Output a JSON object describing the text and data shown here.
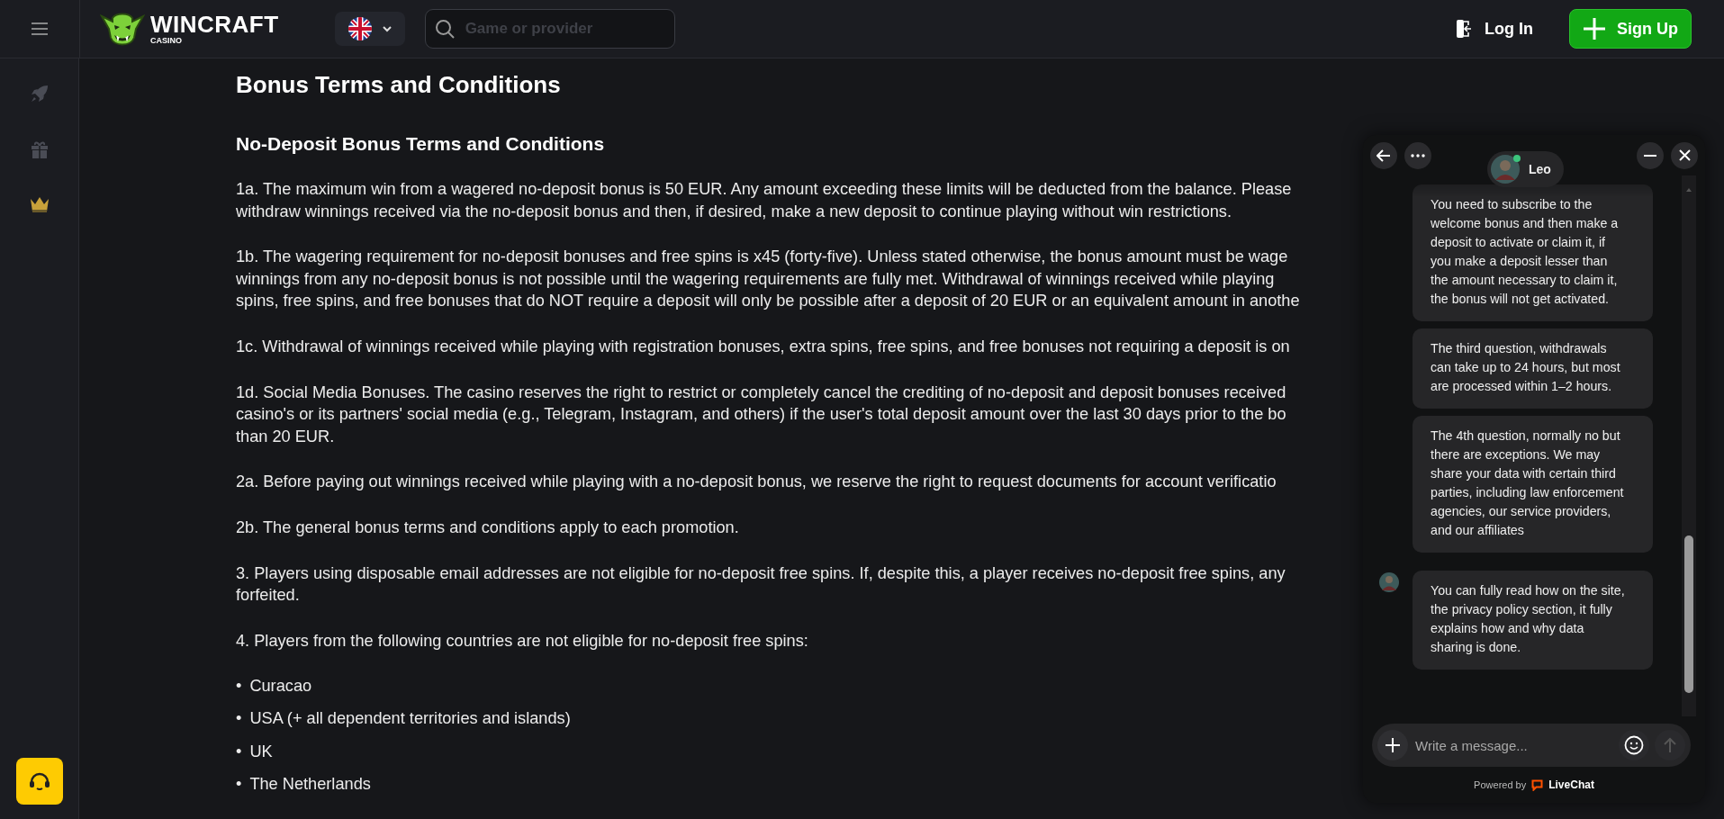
{
  "header": {
    "logo": {
      "name": "WINCRAFT",
      "sub": "CASINO"
    },
    "search": {
      "placeholder": "Game or provider"
    },
    "login": "Log In",
    "signup": "Sign Up"
  },
  "page": {
    "title": "Bonus Terms and Conditions",
    "subtitle": "No-Deposit Bonus Terms and Conditions",
    "paragraphs": [
      {
        "lines": [
          "1a. The maximum win from a wagered no-deposit bonus is 50 EUR. Any amount exceeding these limits will be deducted from the balance. Please",
          "withdraw winnings received via the no-deposit bonus and then, if desired, make a new deposit to continue playing without win restrictions."
        ]
      },
      {
        "lines": [
          "1b. The wagering requirement for no-deposit bonuses and free spins is x45 (forty-five). Unless stated otherwise, the bonus amount must be wage",
          "winnings from any no-deposit bonus is not possible until the wagering requirements are fully met. Withdrawal of winnings received while playing",
          "spins, free spins, and free bonuses that do NOT require a deposit will only be possible after a deposit of 20 EUR or an equivalent amount in anothe"
        ]
      },
      {
        "lines": [
          "1c. Withdrawal of winnings received while playing with registration bonuses, extra spins, free spins, and free bonuses not requiring a deposit is on"
        ]
      },
      {
        "lines": [
          "1d. Social Media Bonuses. The casino reserves the right to restrict or completely cancel the crediting of no-deposit and deposit bonuses received",
          "casino's or its partners' social media (e.g., Telegram, Instagram, and others) if the user's total deposit amount over the last 30 days prior to the bo",
          "than 20 EUR."
        ]
      },
      {
        "lines": [
          "2a. Before paying out winnings received while playing with a no-deposit bonus, we reserve the right to request documents for account verificatio"
        ]
      },
      {
        "lines": [
          "2b. The general bonus terms and conditions apply to each promotion."
        ]
      },
      {
        "lines": [
          "3. Players using disposable email addresses are not eligible for no-deposit free spins. If, despite this, a player receives no-deposit free spins, any",
          "forfeited."
        ]
      },
      {
        "lines": [
          "4. Players from the following countries are not eligible for no-deposit free spins:"
        ]
      }
    ],
    "list": [
      {
        "marker": "•",
        "text": "Curacao"
      },
      {
        "marker": "•",
        "text": "USA (+ all dependent territories and islands)"
      },
      {
        "marker": "•",
        "text": "UK"
      },
      {
        "marker": "•",
        "text": "The Netherlands"
      }
    ]
  },
  "chat": {
    "agent": {
      "name": "Leo",
      "online": true
    },
    "messages": [
      {
        "text": "You need to subscribe to the welcome bonus and then make a deposit to activate or claim it, if you make a deposit lesser than the amount necessary to claim it, the bonus will not get activated.",
        "avatar": false
      },
      {
        "text": "The third question, withdrawals can take up to 24 hours, but most are processed within 1–2 hours.",
        "avatar": false
      },
      {
        "text": "The 4th question, normally no but there are exceptions. We may share your data with certain third parties, including law enforcement agencies, our service providers, and our affiliates",
        "avatar": false
      },
      {
        "text": "You can fully read how on the site, the privacy policy section, it fully explains how and why data sharing is done.",
        "avatar": true
      }
    ],
    "input": {
      "placeholder": "Write a message..."
    },
    "powered_by": "Powered by",
    "brand": "LiveChat"
  }
}
